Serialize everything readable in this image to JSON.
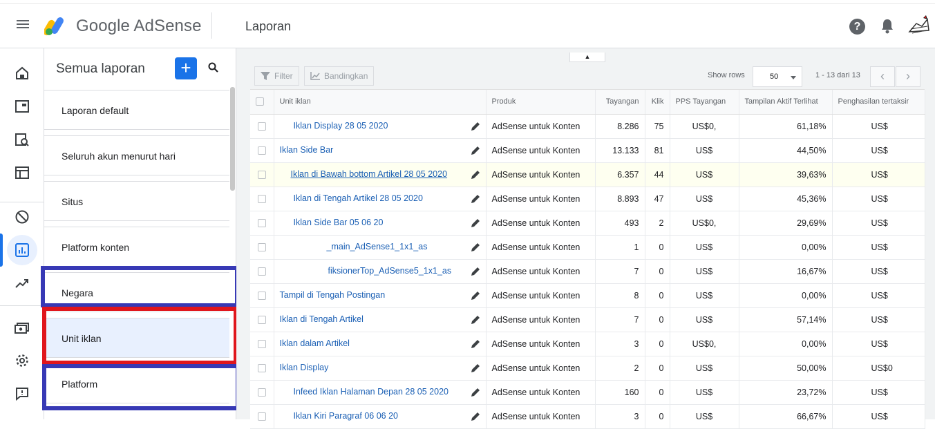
{
  "header": {
    "brand": "Google AdSense",
    "title": "Laporan"
  },
  "reports": {
    "title": "Semua laporan",
    "add_label": "+",
    "items": [
      {
        "label": "Laporan default"
      },
      {
        "label": "Seluruh akun menurut hari"
      },
      {
        "label": "Situs"
      },
      {
        "label": "Platform konten"
      },
      {
        "label": "Negara"
      },
      {
        "label": "Unit iklan"
      },
      {
        "label": "Platform"
      }
    ]
  },
  "toolbar": {
    "filter_label": "Filter",
    "compare_label": "Bandingkan",
    "show_rows_label": "Show rows",
    "rows_value": "50",
    "pager_text": "1 - 13 dari 13"
  },
  "table": {
    "headers": {
      "unit": "Unit iklan",
      "product": "Produk",
      "impressions": "Tayangan",
      "clicks": "Klik",
      "rpm": "PPS Tayangan",
      "active_view": "Tampilan Aktif Terlihat",
      "earnings": "Penghasilan tertaksir"
    },
    "rows": [
      {
        "unit": "Iklan Display 28 05 2020",
        "product": "AdSense untuk Konten",
        "impressions": "8.286",
        "clicks": "75",
        "rpm": "US$0,",
        "active_view": "61,18%",
        "earnings": "US$"
      },
      {
        "unit": "Iklan Side Bar",
        "product": "AdSense untuk Konten",
        "impressions": "13.133",
        "clicks": "81",
        "rpm": "US$",
        "active_view": "44,50%",
        "earnings": "US$"
      },
      {
        "unit": "Iklan di Bawah bottom Artikel 28 05 2020",
        "product": "AdSense untuk Konten",
        "impressions": "6.357",
        "clicks": "44",
        "rpm": "US$",
        "active_view": "39,63%",
        "earnings": "US$"
      },
      {
        "unit": "Iklan di Tengah Artikel 28 05 2020",
        "product": "AdSense untuk Konten",
        "impressions": "8.893",
        "clicks": "47",
        "rpm": "US$",
        "active_view": "45,36%",
        "earnings": "US$"
      },
      {
        "unit": "Iklan Side Bar 05 06 20",
        "product": "AdSense untuk Konten",
        "impressions": "493",
        "clicks": "2",
        "rpm": "US$0,",
        "active_view": "29,69%",
        "earnings": "US$"
      },
      {
        "unit": "_main_AdSense1_1x1_as",
        "product": "AdSense untuk Konten",
        "impressions": "1",
        "clicks": "0",
        "rpm": "US$",
        "active_view": "0,00%",
        "earnings": "US$"
      },
      {
        "unit": "fiksionerTop_AdSense5_1x1_as",
        "product": "AdSense untuk Konten",
        "impressions": "7",
        "clicks": "0",
        "rpm": "US$",
        "active_view": "16,67%",
        "earnings": "US$"
      },
      {
        "unit": "Tampil di Tengah Postingan",
        "product": "AdSense untuk Konten",
        "impressions": "8",
        "clicks": "0",
        "rpm": "US$",
        "active_view": "0,00%",
        "earnings": "US$"
      },
      {
        "unit": "Iklan di Tengah Artikel",
        "product": "AdSense untuk Konten",
        "impressions": "7",
        "clicks": "0",
        "rpm": "US$",
        "active_view": "57,14%",
        "earnings": "US$"
      },
      {
        "unit": "Iklan dalam Artikel",
        "product": "AdSense untuk Konten",
        "impressions": "3",
        "clicks": "0",
        "rpm": "US$0,",
        "active_view": "0,00%",
        "earnings": "US$"
      },
      {
        "unit": "Iklan Display",
        "product": "AdSense untuk Konten",
        "impressions": "2",
        "clicks": "0",
        "rpm": "US$",
        "active_view": "50,00%",
        "earnings": "US$0"
      },
      {
        "unit": "Infeed Iklan Halaman Depan 28 05 2020",
        "product": "AdSense untuk Konten",
        "impressions": "160",
        "clicks": "0",
        "rpm": "US$",
        "active_view": "23,72%",
        "earnings": "US$"
      },
      {
        "unit": "Iklan Kiri Paragraf 06 06 20",
        "product": "AdSense untuk Konten",
        "impressions": "3",
        "clicks": "0",
        "rpm": "US$",
        "active_view": "66,67%",
        "earnings": "US$"
      }
    ]
  },
  "colors": {
    "accent": "#1a73e8",
    "highlight_blue": "#3739b5",
    "highlight_red": "#e0161c"
  },
  "icons": {
    "menu": "menu-icon",
    "help": "help-icon",
    "bell": "bell-icon",
    "search": "search-icon",
    "pencil": "pencil-icon"
  }
}
